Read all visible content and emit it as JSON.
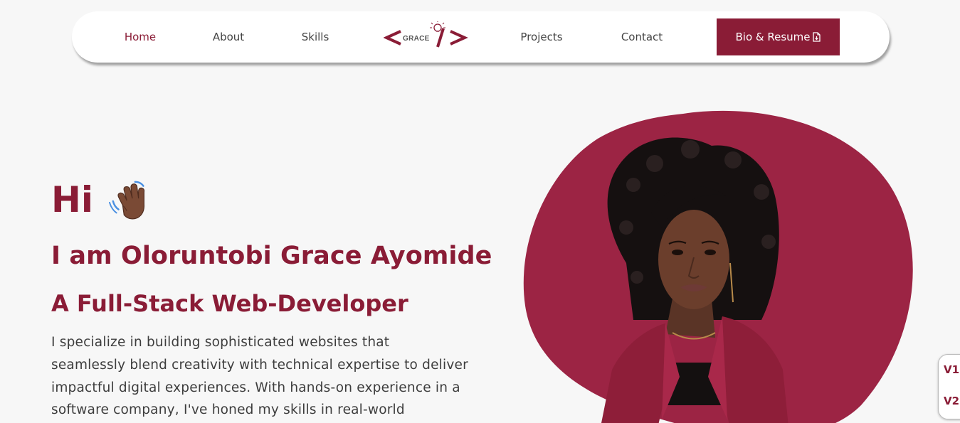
{
  "nav": {
    "links": [
      "Home",
      "About",
      "Skills",
      "Projects",
      "Contact"
    ],
    "active": "Home",
    "logo_text": "GRACE",
    "cta_label": "Bio & Resume"
  },
  "hero": {
    "greeting": "Hi",
    "name": "I am Oloruntobi Grace Ayomide",
    "role": "A Full-Stack Web-Developer",
    "description_lines": [
      "I specialize in building sophisticated websites that",
      "seamlessly blend creativity with technical expertise to deliver",
      "impactful digital experiences. With hands-on experience in a",
      "software company, I've honed my skills in real-world"
    ]
  },
  "version_switch": {
    "options": [
      "V1",
      "V2"
    ]
  },
  "colors": {
    "brand": "#8a1c36",
    "blob": "#9c2444",
    "background": "#f7f7f7"
  },
  "icons": [
    "waving-hand-icon",
    "file-download-icon",
    "lightbulb-icon"
  ]
}
